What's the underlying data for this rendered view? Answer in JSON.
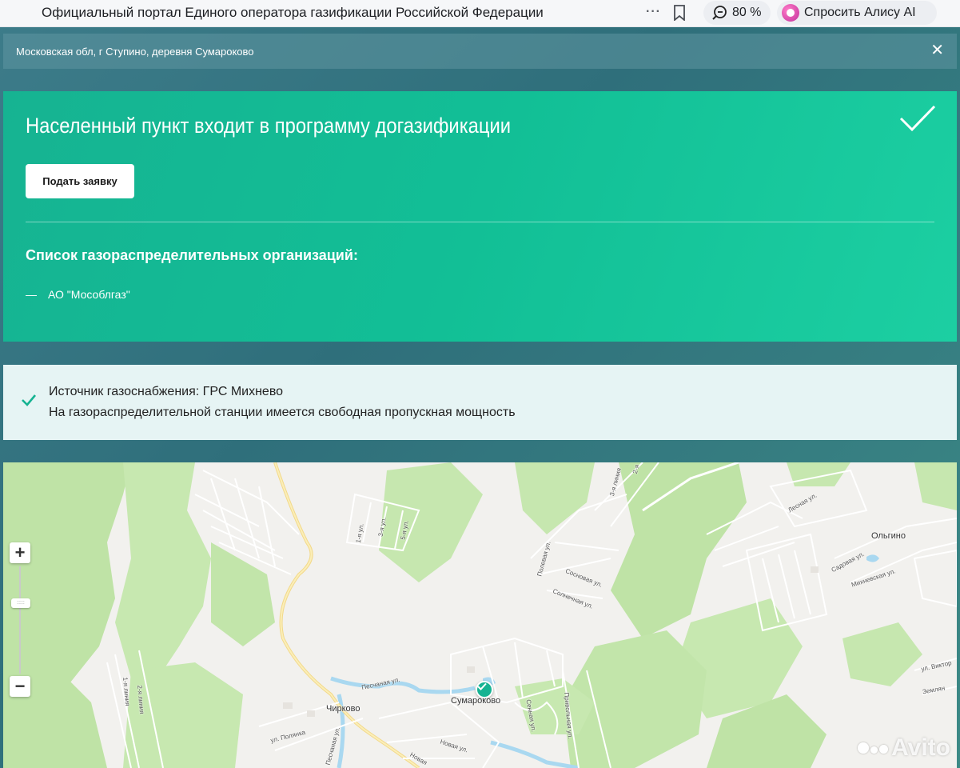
{
  "browser": {
    "title": "Официальный портал Единого оператора газификации Российской Федерации",
    "zoom": "80 %",
    "alice_button": "Спросить Алису AI"
  },
  "location": {
    "text": "Московская обл, г Ступино, деревня Сумароково"
  },
  "status_card": {
    "title": "Населенный пункт входит в программу догазификации",
    "apply_button": "Подать заявку",
    "orgs_heading": "Список газораспределительных организаций:",
    "org_dash": "—",
    "orgs": [
      "АО \"Мособлгаз\""
    ]
  },
  "source_card": {
    "line1": "Источник газоснабжения: ГРС Михнево",
    "line2": "На газораспределительной станции имеется свободная пропускная мощность"
  },
  "map": {
    "labels": {
      "chirkovo": "Чирково",
      "sumarokovo": "Сумароково",
      "olgino": "Ольгино",
      "pesochnaya": "Песчаная ул.",
      "polyanka": "ул. Полянка",
      "pesochnaya2": "Песчаная ул.",
      "novaya": "Новая ул.",
      "novaya2": "Новая",
      "polevaya": "Полевая ул.",
      "sosnovaya": "Сосновая ул.",
      "solnechnaya": "Солнечная ул.",
      "lesnaya": "Лесная ул.",
      "sadovaya": "Садовая ул.",
      "mikhnevskaya": "Михневская ул.",
      "viktor": "ул. Виктор",
      "zemlyan": "Землян",
      "privolnaya": "Привольная ул.",
      "sennaya": "Сенная ул.",
      "line1": "1-я линия",
      "line2": "2-я линия",
      "line3": "3-я линия",
      "line2b": "2-я",
      "ul1": "1-я ул.",
      "ul3": "3-я ул.",
      "ul5": "5-я ул."
    },
    "zoom_in": "+",
    "zoom_out": "−",
    "handle": ":::::"
  },
  "watermark": "Avito",
  "colors": {
    "accent_green": "#16b392",
    "forest": "#bfe3a6",
    "water": "#a9d8f0"
  }
}
